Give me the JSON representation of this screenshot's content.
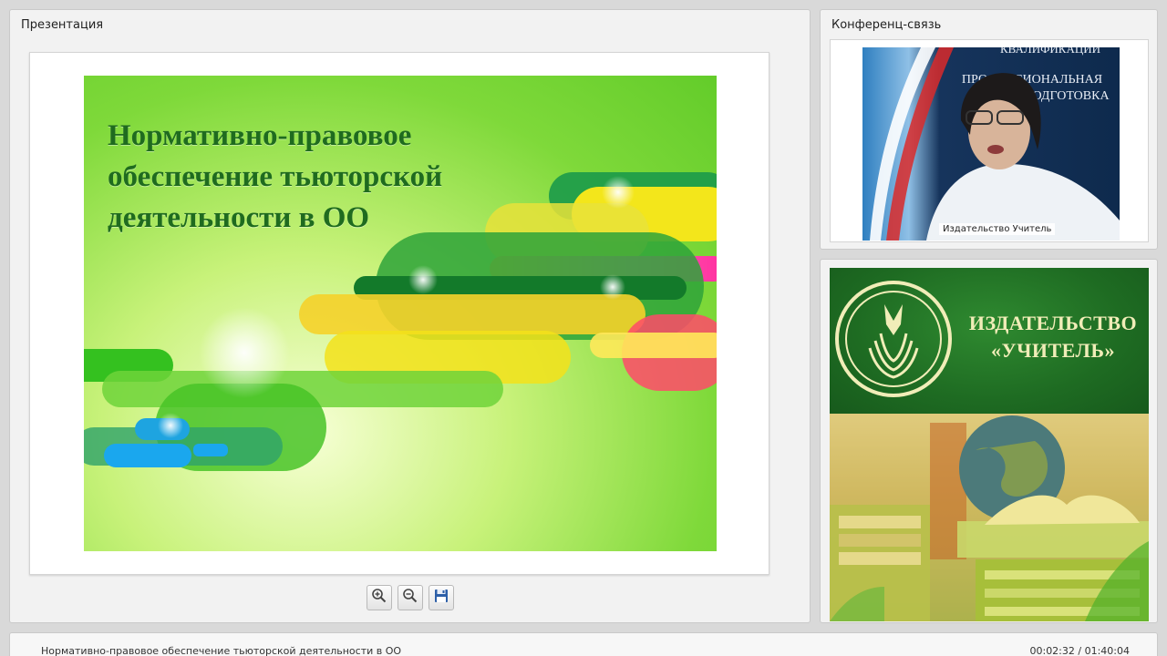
{
  "presentation": {
    "panel_title": "Презентация",
    "slide_title": "Нормативно-правовое\nобеспечение тьюторской\nдеятельности в ОО",
    "toolbar": {
      "zoom_in_icon": "zoom-in-icon",
      "zoom_out_icon": "zoom-out-icon",
      "save_icon": "save-icon"
    }
  },
  "conference": {
    "panel_title": "Конференц-связь",
    "video_caption": "Издательство Учитель",
    "background_sign_text": "КВАЛИФИКАЦИИ\nПРОФЕССИОНАЛЬНАЯ\nПЕРЕПОДГОТОВКА"
  },
  "banner": {
    "brand_line1": "ИЗДАТЕЛЬСТВО",
    "brand_line2": "«УЧИТЕЛЬ»"
  },
  "footer": {
    "title": "Нормативно-правовое обеспечение тьюторской деятельности в ОО",
    "time": "00:02:32 / 01:40:04"
  },
  "colors": {
    "slide_title": "#1f6b1f",
    "banner_green": "#1e6b22",
    "banner_text": "#f1edb8"
  }
}
